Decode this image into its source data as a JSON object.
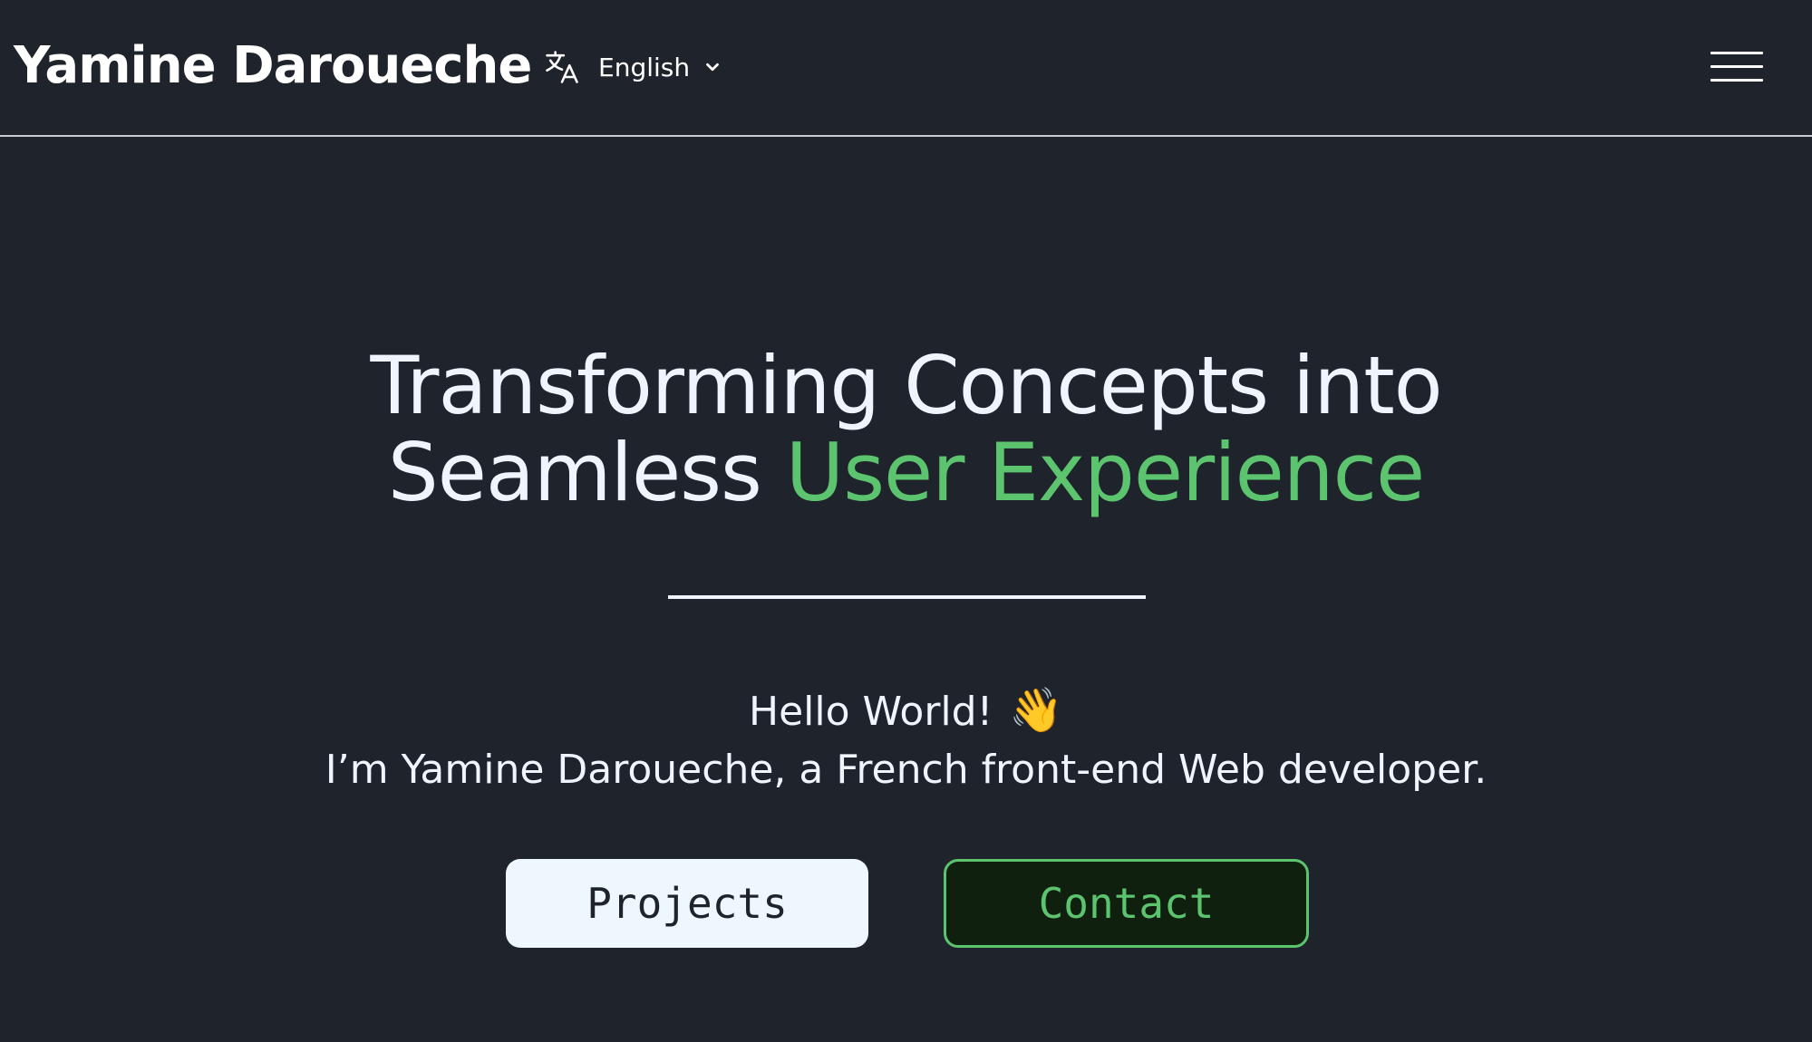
{
  "header": {
    "brand": "Yamine Daroueche",
    "language": {
      "icon": "translate-icon",
      "label": "English",
      "chevron": "chevron-down-icon"
    },
    "menu_icon": "hamburger-menu-icon"
  },
  "hero": {
    "title_line1": "Transforming Concepts into",
    "title_line2_prefix": "Seamless ",
    "title_line2_accent": "User Experience",
    "greeting": "Hello World!",
    "wave_emoji": "👋",
    "intro": "I’m Yamine Daroueche, a French front-end Web developer."
  },
  "actions": {
    "projects_label": "Projects",
    "contact_label": "Contact"
  },
  "colors": {
    "background": "#1f232b",
    "text": "#eef5ff",
    "accent": "#5cc46e",
    "contact_bg": "#10200f",
    "projects_bg": "#eef7fd"
  }
}
